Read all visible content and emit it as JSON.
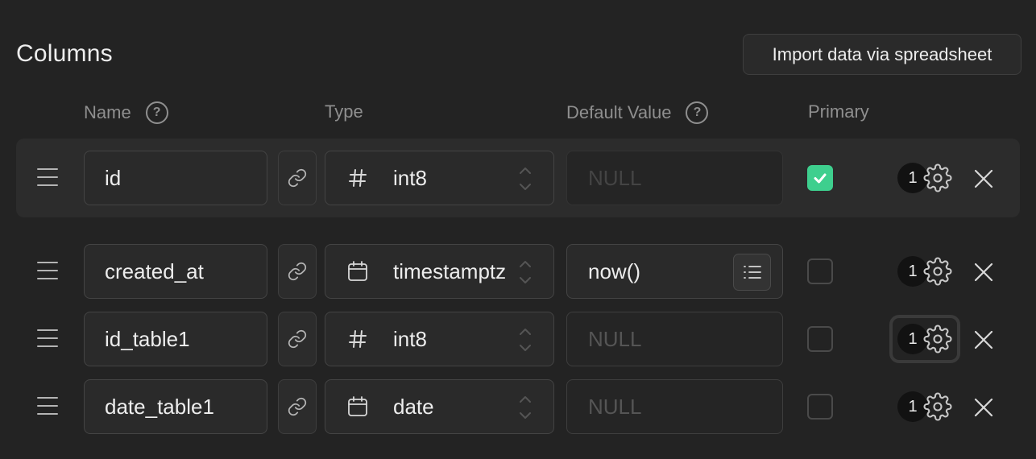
{
  "section": {
    "title": "Columns",
    "import_button": "Import data via spreadsheet"
  },
  "headers": {
    "name": "Name",
    "type": "Type",
    "default_value": "Default Value",
    "primary": "Primary",
    "help_glyph": "?"
  },
  "rows": [
    {
      "name": "id",
      "type": "int8",
      "type_icon": "hash-icon",
      "default_value": "",
      "default_placeholder": "NULL",
      "primary": true,
      "badge": "1"
    },
    {
      "name": "created_at",
      "type": "timestamptz",
      "type_icon": "calendar-icon",
      "default_value": "now()",
      "default_placeholder": "",
      "primary": false,
      "badge": "1"
    },
    {
      "name": "id_table1",
      "type": "int8",
      "type_icon": "hash-icon",
      "default_value": "",
      "default_placeholder": "NULL",
      "primary": false,
      "badge": "1"
    },
    {
      "name": "date_table1",
      "type": "date",
      "type_icon": "calendar-icon",
      "default_value": "",
      "default_placeholder": "NULL",
      "primary": false,
      "badge": "1"
    }
  ],
  "colors": {
    "background": "#232323",
    "primary_check": "#3ecf8e"
  }
}
